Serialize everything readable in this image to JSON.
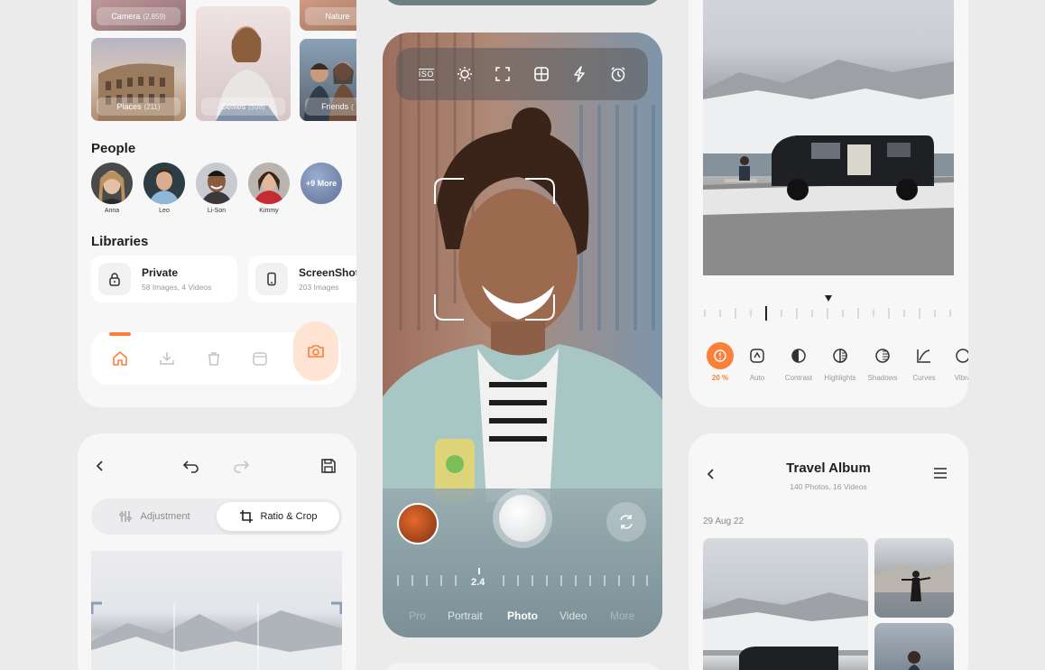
{
  "gallery": {
    "albums": [
      {
        "name": "Camera",
        "count": "(2,859)"
      },
      {
        "name": "Nature",
        "count": ""
      },
      {
        "name": "Places",
        "count": "(211)"
      },
      {
        "name": "Selfies",
        "count": "(598)"
      },
      {
        "name": "Friends",
        "count": "("
      }
    ],
    "people_title": "People",
    "people": [
      {
        "name": "Anna"
      },
      {
        "name": "Leo"
      },
      {
        "name": "Li-Son"
      },
      {
        "name": "Kimmy"
      }
    ],
    "more_label": "+9 More",
    "libraries_title": "Libraries",
    "libraries": [
      {
        "title": "Private",
        "sub": "58 Images, 4 Videos"
      },
      {
        "title": "ScreenShot",
        "sub": "203 Images"
      }
    ],
    "tabs": [
      "home-icon",
      "download-icon",
      "trash-icon",
      "calendar-icon",
      "camera-icon"
    ],
    "accent": "#fb7f39"
  },
  "editor": {
    "seg_adjustment": "Adjustment",
    "seg_crop": "Ratio & Crop"
  },
  "camera": {
    "tools": [
      "ISO",
      "brightness-icon",
      "focus-frame-icon",
      "grid-icon",
      "flash-icon",
      "timer-icon"
    ],
    "iso_label": "ISO",
    "zoom_value": "2.4",
    "modes": [
      "Pro",
      "Portrait",
      "Photo",
      "Video",
      "More"
    ],
    "active_mode": "Photo"
  },
  "adjust": {
    "value_label": "20 %",
    "tools": [
      "Auto",
      "Contrast",
      "Highlights",
      "Shadows",
      "Curves",
      "Vibra"
    ]
  },
  "album": {
    "title": "Travel Album",
    "subtitle": "140 Photos, 16 Videos",
    "date": "29 Aug 22"
  }
}
